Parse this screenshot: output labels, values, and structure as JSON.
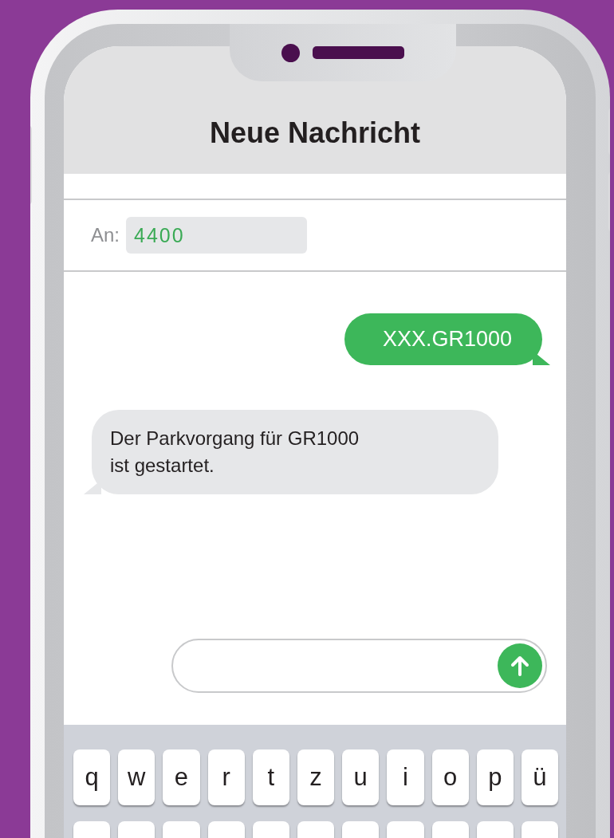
{
  "header": {
    "title": "Neue Nachricht"
  },
  "recipient": {
    "label": "An:",
    "value": "4400"
  },
  "messages": [
    {
      "kind": "sent",
      "text": "XXX.GR1000"
    },
    {
      "kind": "received",
      "text": "Der Parkvorgang für GR1000\nist gestartet."
    }
  ],
  "keyboard": {
    "rows": [
      [
        "q",
        "w",
        "e",
        "r",
        "t",
        "z",
        "u",
        "i",
        "o",
        "p",
        "ü"
      ]
    ]
  }
}
